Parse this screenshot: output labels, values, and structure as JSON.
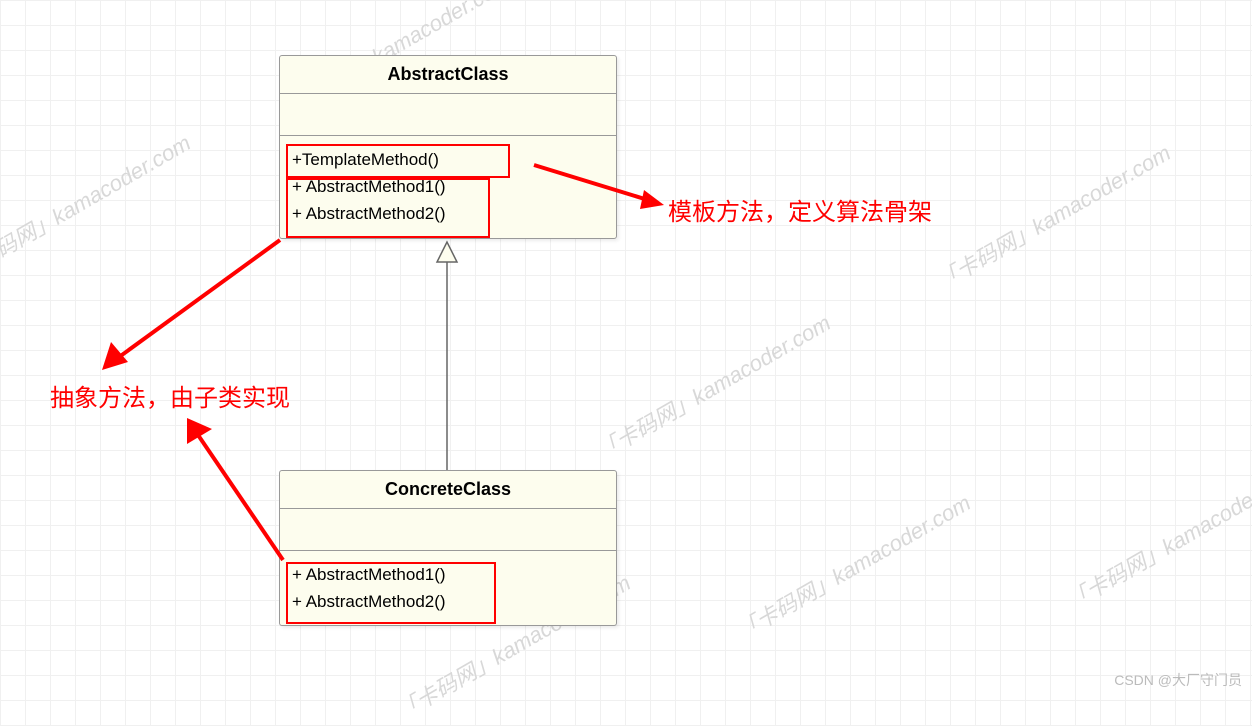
{
  "diagram": {
    "abstractClass": {
      "name": "AbstractClass",
      "ops": {
        "template": "+TemplateMethod()",
        "m1": "+ AbstractMethod1()",
        "m2": "+ AbstractMethod2()"
      }
    },
    "concreteClass": {
      "name": "ConcreteClass",
      "ops": {
        "m1": "+ AbstractMethod1()",
        "m2": "+ AbstractMethod2()"
      }
    },
    "annotations": {
      "templateMethod": "模板方法，定义算法骨架",
      "abstractMethod": "抽象方法，由子类实现"
    },
    "watermark": "「卡码网」kamacoder.com",
    "credit": "CSDN @大厂守门员"
  }
}
